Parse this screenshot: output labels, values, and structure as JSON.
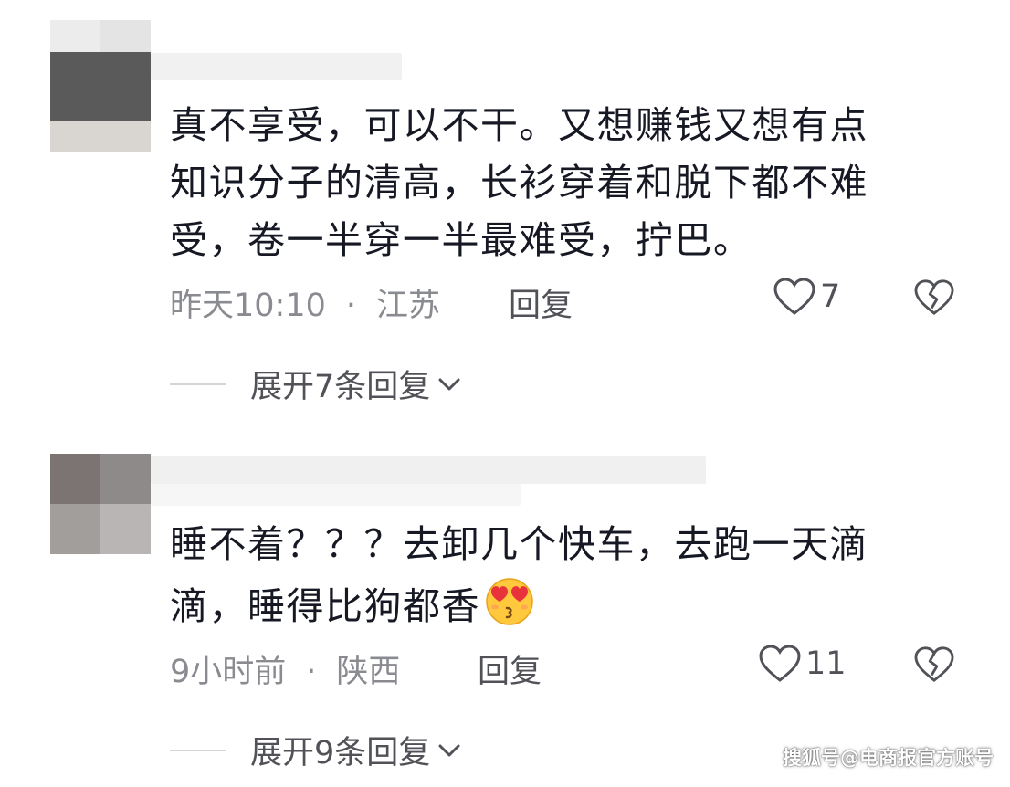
{
  "comments": [
    {
      "text_lines": [
        "真不享受，可以不干。又想赚钱又想有点",
        "知识分子的清高，长衫穿着和脱下都不难",
        "受，卷一半穿一半最难受，拧巴。"
      ],
      "time": "昨天10:10",
      "separator": "·",
      "location": "江苏",
      "reply_label": "回复",
      "likes": "7",
      "expand_label": "展开7条回复"
    },
    {
      "text_lines": [
        "睡不着？？？去卸几个快车，去跑一天滴",
        "滴，睡得比狗都香"
      ],
      "emoji": "heart-eyes-kiss-emoji",
      "time": "9小时前",
      "separator": "·",
      "location": "陕西",
      "reply_label": "回复",
      "likes": "11",
      "expand_label": "展开9条回复"
    }
  ],
  "icons": {
    "like": "heart-outline-icon",
    "dislike": "broken-heart-icon",
    "expand": "chevron-down-icon"
  },
  "colors": {
    "text": "#161823",
    "meta": "#8a8b91",
    "action": "#515258"
  },
  "watermark": "搜狐号@电商报官方账号"
}
